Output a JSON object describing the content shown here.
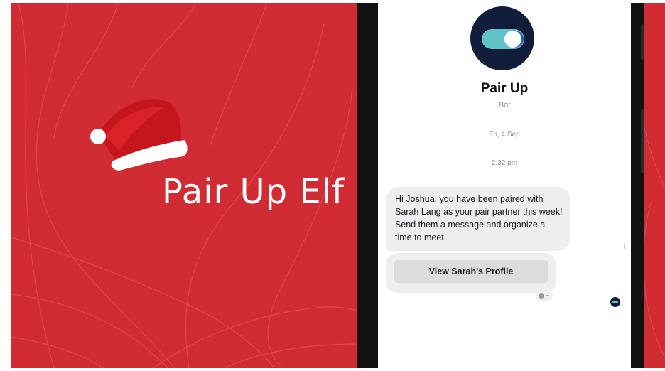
{
  "brand": {
    "title": "Pair Up Elf",
    "background_color": "#d12b33",
    "hat_icon": "santa-hat-icon"
  },
  "chat": {
    "bot_name": "Pair Up",
    "bot_subtitle": "Bot",
    "avatar_icon": "toggle-switch-icon",
    "date": "Fri, 4 Sep",
    "time": "2:32 pm",
    "message": "Hi Joshua, you have been paired with Sarah Lang as your pair partner this week! Send them a message and organize a time to meet.",
    "button_label": "View Sarah's Profile",
    "accent_color": "#5fc3c8",
    "avatar_color": "#111d3a"
  }
}
